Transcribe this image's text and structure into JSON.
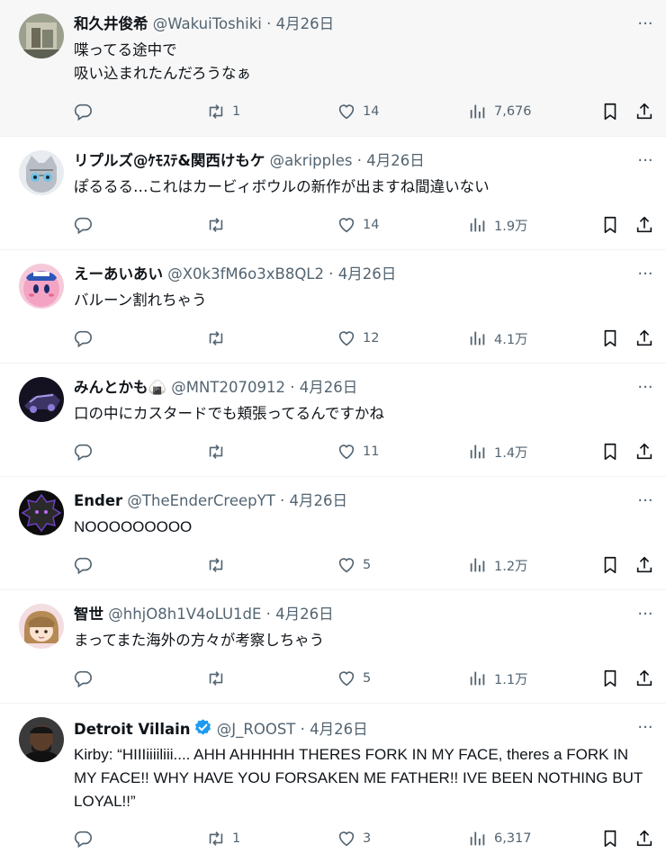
{
  "tweets": [
    {
      "display_name": "和久井俊希",
      "handle": "@WakuiToshiki",
      "date": "4月26日",
      "verified": false,
      "text_lines": [
        "喋ってる途中で",
        "吸い込まれたんだろうなぁ"
      ],
      "replies": "",
      "retweets": "1",
      "likes": "14",
      "views": "7,676",
      "avatar_color": "#8a8f7a",
      "highlighted": true
    },
    {
      "display_name": "リプルズ@ｹﾓｽﾃ&関西けもケ",
      "handle": "@akripples",
      "date": "4月26日",
      "verified": false,
      "text_lines": [
        "ぽるるる…これはカービィボウルの新作が出ますね間違いない"
      ],
      "replies": "",
      "retweets": "",
      "likes": "14",
      "views": "1.9万",
      "avatar_color": "#d9dde4",
      "highlighted": false
    },
    {
      "display_name": "えーあいあい",
      "handle": "@X0k3fM6o3xB8QL2",
      "date": "4月26日",
      "verified": false,
      "text_lines": [
        "バルーン割れちゃう"
      ],
      "replies": "",
      "retweets": "",
      "likes": "12",
      "views": "4.1万",
      "avatar_color": "#f3a3c4",
      "highlighted": false
    },
    {
      "display_name": "みんとかも🍙",
      "handle": "@MNT2070912",
      "date": "4月26日",
      "verified": false,
      "text_lines": [
        "口の中にカスタードでも頬張ってるんですかね"
      ],
      "replies": "",
      "retweets": "",
      "likes": "11",
      "views": "1.4万",
      "avatar_color": "#1c1a2a",
      "highlighted": false
    },
    {
      "display_name": "Ender",
      "handle": "@TheEnderCreepYT",
      "date": "4月26日",
      "verified": false,
      "text_lines": [
        "NOOOOOOOOO"
      ],
      "replies": "",
      "retweets": "",
      "likes": "5",
      "views": "1.2万",
      "avatar_color": "#1a1a1a",
      "highlighted": false
    },
    {
      "display_name": "智世",
      "handle": "@hhjO8h1V4oLU1dE",
      "date": "4月26日",
      "verified": false,
      "text_lines": [
        "まってまた海外の方々が考察しちゃう"
      ],
      "replies": "",
      "retweets": "",
      "likes": "5",
      "views": "1.1万",
      "avatar_color": "#f2d9dc",
      "highlighted": false
    },
    {
      "display_name": "Detroit Villain",
      "handle": "@J_ROOST",
      "date": "4月26日",
      "verified": true,
      "text_lines": [
        "Kirby: “HIIIiiiiliii.... AHH AHHHHH THERES FORK IN MY FACE, theres a FORK IN",
        "MY FACE!! WHY HAVE YOU FORSAKEN ME FATHER!! IVE BEEN NOTHING BUT",
        "LOYAL!!”"
      ],
      "replies": "",
      "retweets": "1",
      "likes": "3",
      "views": "6,317",
      "avatar_color": "#2a2a2a",
      "highlighted": false
    }
  ],
  "separator": "·",
  "more_label": "···",
  "icons": {
    "reply": "reply-icon",
    "retweet": "retweet-icon",
    "like": "heart-icon",
    "views": "views-icon",
    "bookmark": "bookmark-icon",
    "share": "share-icon",
    "verified": "verified-badge-icon"
  },
  "colors": {
    "text": "#0f1419",
    "secondary": "#536471",
    "verified": "#1d9bf0",
    "divider": "#eff3f4"
  }
}
